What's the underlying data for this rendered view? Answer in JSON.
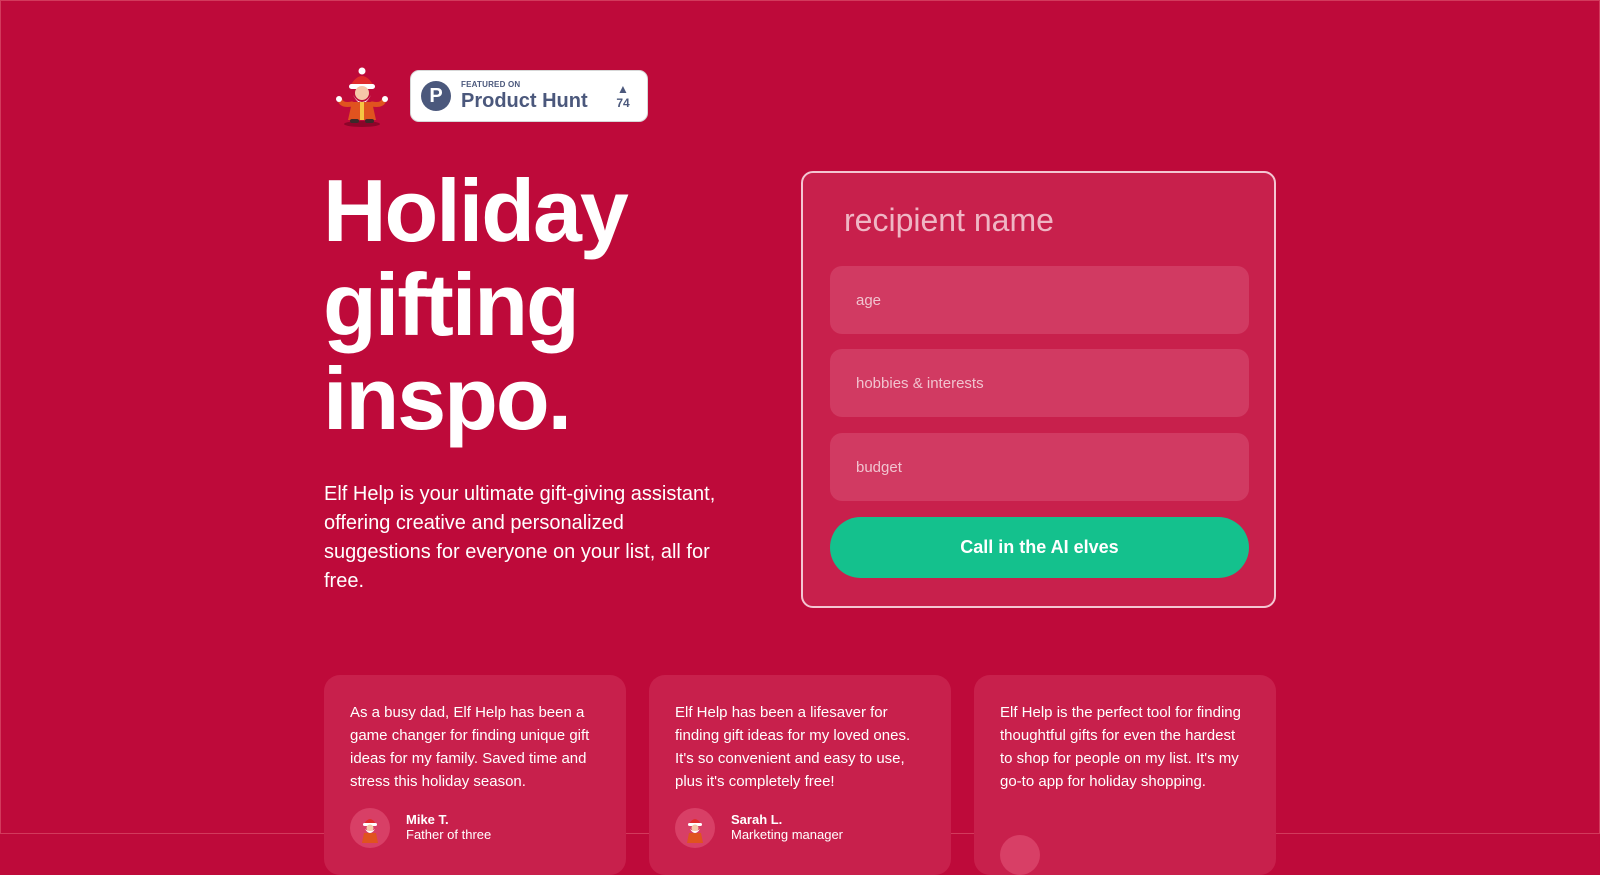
{
  "header": {
    "product_hunt": {
      "featured_label": "FEATURED ON",
      "name": "Product Hunt",
      "logo_letter": "P",
      "upvote_arrow": "▲",
      "votes": "74"
    }
  },
  "hero": {
    "title_lines": [
      "Holiday",
      "gifting",
      "inspo."
    ],
    "description": "Elf Help is your ultimate gift-giving assistant, offering creative and personalized suggestions for everyone on your list, all for free."
  },
  "form": {
    "recipient_placeholder": "recipient name",
    "age_placeholder": "age",
    "hobbies_placeholder": "hobbies & interests",
    "budget_placeholder": "budget",
    "submit_label": "Call in the AI elves"
  },
  "testimonials": [
    {
      "quote": "As a busy dad, Elf Help has been a game changer for finding unique gift ideas for my family. Saved time and stress this holiday season.",
      "name": "Mike T.",
      "role": "Father of three"
    },
    {
      "quote": "Elf Help has been a lifesaver for finding gift ideas for my loved ones. It's so convenient and easy to use, plus it's completely free!",
      "name": "Sarah L.",
      "role": "Marketing manager"
    },
    {
      "quote": "Elf Help is the perfect tool for finding thoughtful gifts for even the hardest to shop for people on my list. It's my go-to app for holiday shopping.",
      "name": "",
      "role": ""
    }
  ],
  "colors": {
    "background": "#be0a3a",
    "card": "#c8204c",
    "input": "#d13a62",
    "button": "#14c18d",
    "product_hunt_text": "#4b587c"
  },
  "icons": {
    "logo": "santa-icon",
    "product_hunt": "product-hunt-icon",
    "avatar": "santa-avatar-icon"
  }
}
